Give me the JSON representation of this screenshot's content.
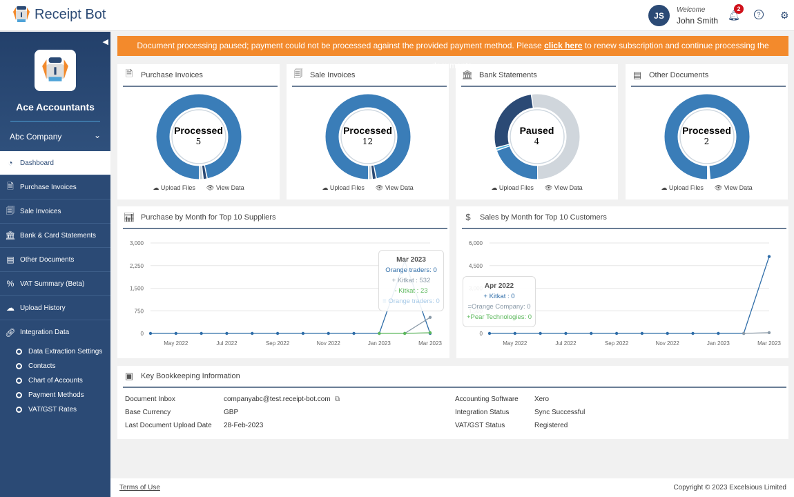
{
  "header": {
    "brand": "Receipt Bot",
    "user_initials": "JS",
    "welcome": "Welcome",
    "user_name": "John Smith",
    "notification_count": "2"
  },
  "sidebar": {
    "org_name": "Ace Accountants",
    "company": "Abc Company",
    "items": [
      {
        "label": "Dashboard",
        "icon": "gauge-icon"
      },
      {
        "label": "Purchase Invoices",
        "icon": "purchase-invoice-icon"
      },
      {
        "label": "Sale Invoices",
        "icon": "sale-invoice-icon"
      },
      {
        "label": "Bank & Card Statements",
        "icon": "bank-icon"
      },
      {
        "label": "Other Documents",
        "icon": "document-icon"
      },
      {
        "label": "VAT Summary (Beta)",
        "icon": "percent-icon"
      },
      {
        "label": "Upload History",
        "icon": "cloud-upload-icon"
      },
      {
        "label": "Integration Data",
        "icon": "link-icon"
      }
    ],
    "sub_items": [
      "Data Extraction Settings",
      "Contacts",
      "Chart of Accounts",
      "Payment Methods",
      "VAT/GST Rates"
    ]
  },
  "banner": {
    "before": "Document processing paused; payment could not be processed against the provided payment method. Please ",
    "link": "click here",
    "after": " to renew subscription and continue processing the documents.",
    "color": "#f38a2c"
  },
  "cards": [
    {
      "title": "Purchase Invoices",
      "status": "Processed",
      "count": "5",
      "segments": [
        {
          "value": 0.97,
          "color": "#3a7db8"
        },
        {
          "value": 0.015,
          "color": "#2b4a75"
        },
        {
          "value": 0.015,
          "color": "#c8d3dc"
        }
      ]
    },
    {
      "title": "Sale Invoices",
      "status": "Processed",
      "count": "12",
      "segments": [
        {
          "value": 0.97,
          "color": "#3a7db8"
        },
        {
          "value": 0.015,
          "color": "#2b4a75"
        },
        {
          "value": 0.015,
          "color": "#c8d3dc"
        }
      ]
    },
    {
      "title": "Bank Statements",
      "status": "Paused",
      "count": "4",
      "segments": [
        {
          "value": 0.2,
          "color": "#3a7db8"
        },
        {
          "value": 0.01,
          "color": "#4fb3e0"
        },
        {
          "value": 0.27,
          "color": "#2b4a75"
        },
        {
          "value": 0.52,
          "color": "#d0d6dc"
        }
      ]
    },
    {
      "title": "Other Documents",
      "status": "Processed",
      "count": "2",
      "segments": [
        {
          "value": 0.99,
          "color": "#3a7db8"
        }
      ]
    }
  ],
  "card_links": {
    "upload": "Upload Files",
    "view": "View Data"
  },
  "chart_data": [
    {
      "type": "line",
      "title": "Purchase by Month for Top 10 Suppliers",
      "categories": [
        "Apr 2022",
        "May 2022",
        "Jun 2022",
        "Jul 2022",
        "Aug 2022",
        "Sep 2022",
        "Oct 2022",
        "Nov 2022",
        "Dec 2022",
        "Jan 2023",
        "Feb 2023",
        "Mar 2023"
      ],
      "x_tick_labels": [
        "May 2022",
        "Jul 2022",
        "Sep 2022",
        "Nov 2022",
        "Jan 2023",
        "Mar 2023"
      ],
      "y_ticks": [
        "3,000",
        "2,250",
        "1,500",
        "750",
        "0"
      ],
      "ylim": [
        0,
        3000
      ],
      "series": [
        {
          "color": "#2f6da8",
          "values": [
            0,
            0,
            0,
            0,
            0,
            0,
            0,
            0,
            0,
            0,
            2400,
            0
          ]
        },
        {
          "color": "#8a9aa8",
          "values": [
            null,
            null,
            null,
            null,
            null,
            null,
            null,
            null,
            null,
            null,
            0,
            532
          ]
        },
        {
          "color": "#5cb85c",
          "values": [
            null,
            null,
            null,
            null,
            null,
            null,
            null,
            null,
            null,
            0,
            0,
            23
          ]
        }
      ],
      "tooltip": {
        "title": "Mar 2023",
        "lines": [
          {
            "text": "Orange traders: 0",
            "color": "#2f6da8"
          },
          {
            "text": "+ Kitkat : 532",
            "color": "#8a9aa8"
          },
          {
            "text": "- Kitkat : 23",
            "color": "#5cb85c"
          },
          {
            "text": "= Orange traders: 0",
            "color": "#a9cbe8"
          }
        ]
      }
    },
    {
      "type": "line",
      "title": "Sales by Month for Top 10 Customers",
      "categories": [
        "Apr 2022",
        "May 2022",
        "Jun 2022",
        "Jul 2022",
        "Aug 2022",
        "Sep 2022",
        "Oct 2022",
        "Nov 2022",
        "Dec 2022",
        "Jan 2023",
        "Feb 2023",
        "Mar 2023"
      ],
      "x_tick_labels": [
        "May 2022",
        "Jul 2022",
        "Sep 2022",
        "Nov 2022",
        "Jan 2023",
        "Mar 2023"
      ],
      "y_ticks": [
        "6,000",
        "4,500",
        "3,000",
        "1,500",
        "0"
      ],
      "ylim": [
        0,
        6000
      ],
      "series": [
        {
          "color": "#2f6da8",
          "values": [
            0,
            0,
            0,
            0,
            0,
            0,
            0,
            0,
            0,
            0,
            0,
            5100
          ]
        },
        {
          "color": "#8a9aa8",
          "values": [
            null,
            null,
            null,
            null,
            null,
            null,
            null,
            null,
            null,
            null,
            0,
            50
          ]
        }
      ],
      "tooltip": {
        "title": "Apr 2022",
        "lines": [
          {
            "text": "+ Kitkat : 0",
            "color": "#2f6da8"
          },
          {
            "text": "=Orange Company: 0",
            "color": "#8a9aa8"
          },
          {
            "text": "+Pear Technologies: 0",
            "color": "#5cb85c"
          }
        ]
      }
    }
  ],
  "bookkeeping": {
    "title": "Key Bookkeeping Information",
    "left": [
      {
        "label": "Document Inbox",
        "value": "companyabc@test.receipt-bot.com"
      },
      {
        "label": "Base Currency",
        "value": "GBP"
      },
      {
        "label": "Last Document Upload Date",
        "value": "28-Feb-2023"
      }
    ],
    "right": [
      {
        "label": "Accounting Software",
        "value": "Xero"
      },
      {
        "label": "Integration Status",
        "value": "Sync Successful"
      },
      {
        "label": "VAT/GST Status",
        "value": "Registered"
      }
    ]
  },
  "footer": {
    "terms": "Terms of Use",
    "copyright": "Copyright © 2023 Excelsious Limited"
  }
}
